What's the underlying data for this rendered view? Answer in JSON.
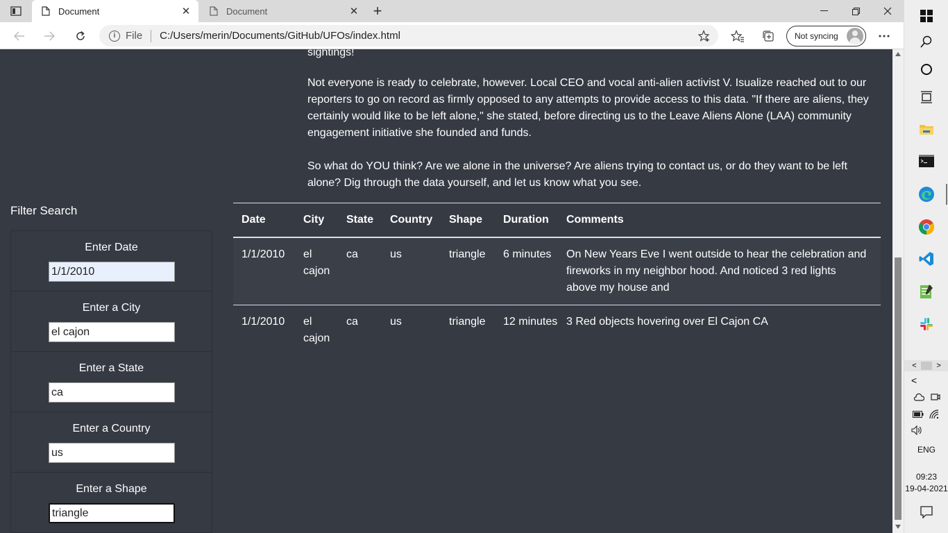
{
  "browser": {
    "tabs": [
      {
        "title": "Document",
        "active": true
      },
      {
        "title": "Document",
        "active": false
      }
    ],
    "address_scheme": "File",
    "url": "C:/Users/merin/Documents/GitHub/UFOs/index.html",
    "profile_label": "Not syncing"
  },
  "article": {
    "top_fragment": "sightings!",
    "paragraph2": "Not everyone is ready to celebrate, however. Local CEO and vocal anti-alien activist V. Isualize reached out to our reporters to go on record as firmly opposed to any attempts to provide access to this data. \"If there are aliens, they certainly would like to be left alone,\" she stated, before directing us to the Leave Aliens Alone (LAA) community engagement initiative she founded and funds.",
    "paragraph3": "So what do YOU think? Are we alone in the universe? Are aliens trying to contact us, or do they want to be left alone? Dig through the data yourself, and let us know what you see."
  },
  "filters": {
    "title": "Filter Search",
    "items": [
      {
        "label": "Enter Date",
        "value": "1/1/2010"
      },
      {
        "label": "Enter a City",
        "value": "el cajon"
      },
      {
        "label": "Enter a State",
        "value": "ca"
      },
      {
        "label": "Enter a Country",
        "value": "us"
      },
      {
        "label": "Enter a Shape",
        "value": "triangle"
      }
    ]
  },
  "table": {
    "headers": [
      "Date",
      "City",
      "State",
      "Country",
      "Shape",
      "Duration",
      "Comments"
    ],
    "rows": [
      [
        "1/1/2010",
        "el cajon",
        "ca",
        "us",
        "triangle",
        "6 minutes",
        "On New Years Eve I went outside to hear the celebration and fireworks in my neighbor hood. And noticed 3 red lights above my house and"
      ],
      [
        "1/1/2010",
        "el cajon",
        "ca",
        "us",
        "triangle",
        "12 minutes",
        "3 Red objects hovering over El Cajon CA"
      ]
    ]
  },
  "taskbar": {
    "language": "ENG",
    "time": "09:23",
    "date": "19-04-2021",
    "icons": [
      "windows-start-icon",
      "search-icon",
      "cortana-icon",
      "task-view-icon",
      "file-explorer-icon",
      "terminal-icon",
      "edge-icon",
      "chrome-icon",
      "vscode-icon",
      "notepad-icon",
      "slack-icon"
    ]
  },
  "colors": {
    "page_background": "#353a43",
    "stripe": "#3a3f48",
    "autofill": "#e8f0fe"
  }
}
